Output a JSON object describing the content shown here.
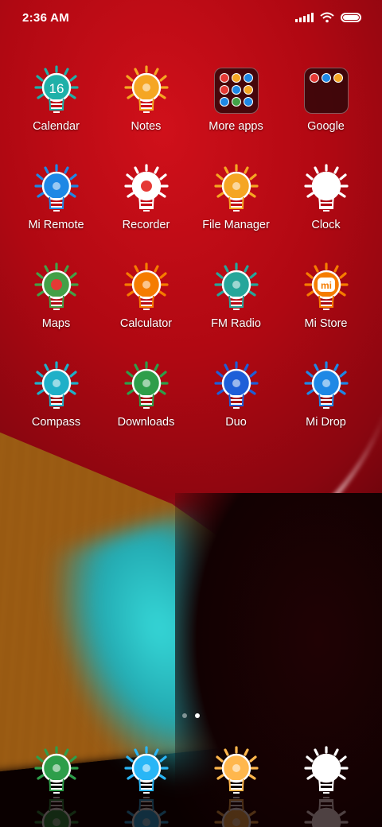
{
  "status_bar": {
    "time": "2:36 AM",
    "battery_icon": "battery-icon",
    "wifi_icon": "wifi-icon",
    "signal_icon": "signal-icon"
  },
  "apps": [
    {
      "label": "Calendar",
      "icon": "calendar-icon",
      "color": "#1fb0a8",
      "glyph": "16"
    },
    {
      "label": "Notes",
      "icon": "notes-icon",
      "color": "#f5a623"
    },
    {
      "label": "More apps",
      "icon": "folder-icon",
      "type": "folder",
      "mini_colors": [
        "#e53935",
        "#f5a623",
        "#1e88e5",
        "#e53935",
        "#1e88e5",
        "#f5a623",
        "#1e88e5",
        "#43a047",
        "#1e88e5"
      ]
    },
    {
      "label": "Google",
      "icon": "google-folder-icon",
      "type": "folder",
      "mini_colors": [
        "#e53935",
        "#1e88e5",
        "#f5a623"
      ]
    },
    {
      "label": "Mi Remote",
      "icon": "mi-remote-icon",
      "color": "#1e88e5"
    },
    {
      "label": "Recorder",
      "icon": "recorder-icon",
      "color": "#ffffff",
      "accent": "#e53935"
    },
    {
      "label": "File Manager",
      "icon": "file-manager-icon",
      "color": "#f5a623"
    },
    {
      "label": "Clock",
      "icon": "clock-icon",
      "color": "#ffffff"
    },
    {
      "label": "Maps",
      "icon": "maps-icon",
      "color": "#43a047",
      "accent": "#e53935"
    },
    {
      "label": "Calculator",
      "icon": "calculator-icon",
      "color": "#f57c00"
    },
    {
      "label": "FM Radio",
      "icon": "fm-radio-icon",
      "color": "#26a69a"
    },
    {
      "label": "Mi Store",
      "icon": "mi-store-icon",
      "color": "#f57c00",
      "glyph": "mi"
    },
    {
      "label": "Compass",
      "icon": "compass-icon",
      "color": "#1fb0c8"
    },
    {
      "label": "Downloads",
      "icon": "downloads-icon",
      "color": "#2e9e4a"
    },
    {
      "label": "Duo",
      "icon": "duo-icon",
      "color": "#1e5fd8"
    },
    {
      "label": "Mi Drop",
      "icon": "mi-drop-icon",
      "color": "#1e88e5"
    }
  ],
  "page_indicator": {
    "pages": 2,
    "active": 2
  },
  "dock": [
    {
      "icon": "phone-icon",
      "color": "#2e9e4a"
    },
    {
      "icon": "messaging-icon",
      "color": "#29b6f6"
    },
    {
      "icon": "browser-icon",
      "color": "#ffb74d"
    },
    {
      "icon": "camera-icon",
      "color": "#ffffff"
    }
  ]
}
